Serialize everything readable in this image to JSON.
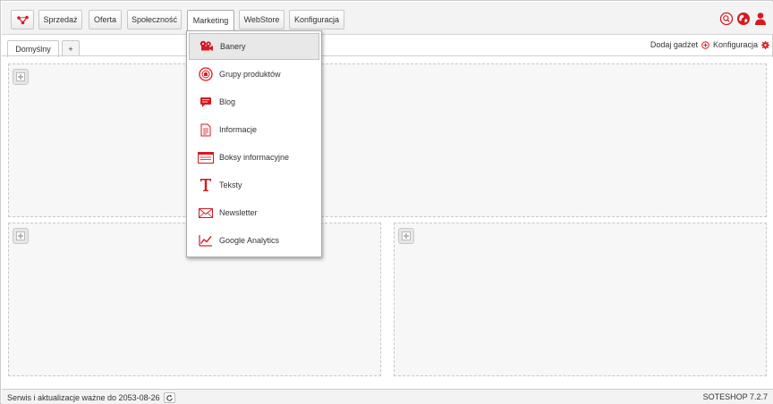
{
  "colors": {
    "accent": "#d71920",
    "panel_bg": "#f7f7f7",
    "bar_bg": "#f3f3f3"
  },
  "nav": {
    "logo_icon": "soteshop-logo-icon",
    "items": [
      {
        "label": "Sprzedaż"
      },
      {
        "label": "Oferta"
      },
      {
        "label": "Społeczność"
      },
      {
        "label": "Marketing",
        "active": true
      },
      {
        "label": "WebStore"
      },
      {
        "label": "Konfiguracja"
      }
    ],
    "right_icons": [
      "search-icon",
      "globe-icon",
      "user-icon"
    ]
  },
  "tabs": {
    "items": [
      {
        "label": "Domyślny",
        "active": true
      },
      {
        "label": "+"
      }
    ],
    "add_gadget": "Dodaj gadżet",
    "config": "Konfiguracja"
  },
  "marketing_menu": {
    "items": [
      {
        "label": "Banery",
        "icon": "banners-icon",
        "highlighted": true
      },
      {
        "label": "Grupy produktów",
        "icon": "product-groups-icon"
      },
      {
        "label": "Blog",
        "icon": "blog-icon"
      },
      {
        "label": "Informacje",
        "icon": "information-icon"
      },
      {
        "label": "Boksy informacyjne",
        "icon": "info-boxes-icon"
      },
      {
        "label": "Teksty",
        "icon": "texts-icon"
      },
      {
        "label": "Newsletter",
        "icon": "newsletter-icon"
      },
      {
        "label": "Google Analytics",
        "icon": "analytics-icon"
      }
    ]
  },
  "footer": {
    "license": "Serwis i aktualizacje ważne do 2053-08-26",
    "version": "SOTESHOP 7.2.7"
  }
}
